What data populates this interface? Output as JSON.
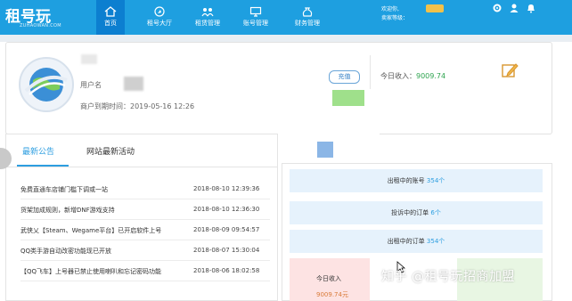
{
  "brand": {
    "logo_text": "租号玩",
    "logo_sub": "ZUHAOWAN.COM"
  },
  "nav": [
    {
      "label": "首页",
      "icon": "home-icon",
      "active": true
    },
    {
      "label": "租号大厅",
      "icon": "compass-icon",
      "active": false
    },
    {
      "label": "租赁管理",
      "icon": "group-icon",
      "active": false
    },
    {
      "label": "账号管理",
      "icon": "monitor-icon",
      "active": false
    },
    {
      "label": "财务管理",
      "icon": "money-bag-icon",
      "active": false
    }
  ],
  "header": {
    "welcome": "欢迎你,",
    "level_label": "卖家等级：",
    "icons": [
      "gear-icon",
      "user-icon",
      "bell-icon"
    ]
  },
  "profile": {
    "user_label": "用户名",
    "expire_label": "商户到期时间：2019-05-16 12:26",
    "recharge_label": "充值",
    "today_income_label": "今日收入：",
    "today_income_value": "9009.74"
  },
  "tabs": {
    "announcements": "最新公告",
    "activities": "网站最新活动"
  },
  "news": [
    {
      "title": "免费直通车店铺门槛下调或一站",
      "date": "2018-08-10 12:39:36"
    },
    {
      "title": "货架加成规则，新增DNF游戏支持",
      "date": "2018-08-10 12:36:30"
    },
    {
      "title": "武侠乂【Steam、Wegame平台】已开启软件上号",
      "date": "2018-08-09 09:54:57"
    },
    {
      "title": "QQ类手游自动改密功能现已开放",
      "date": "2018-08-07 15:30:04"
    },
    {
      "title": "【QQ飞车】上号器已禁止使用喇叭和忘记密码功能",
      "date": "2018-08-06 18:02:58"
    }
  ],
  "stats": [
    {
      "label": "出租中的账号",
      "count": "354个"
    },
    {
      "label": "投诉中的订单",
      "count": "6个"
    },
    {
      "label": "出租中的订单",
      "count": "354个"
    }
  ],
  "today_box": {
    "label": "今日收入",
    "value": "9009.74元"
  },
  "watermark": "知乎 @租号玩招商加盟",
  "colors": {
    "topbar": "#1e9fe0",
    "accent": "#2d9ee0",
    "income": "#2ea44f"
  }
}
